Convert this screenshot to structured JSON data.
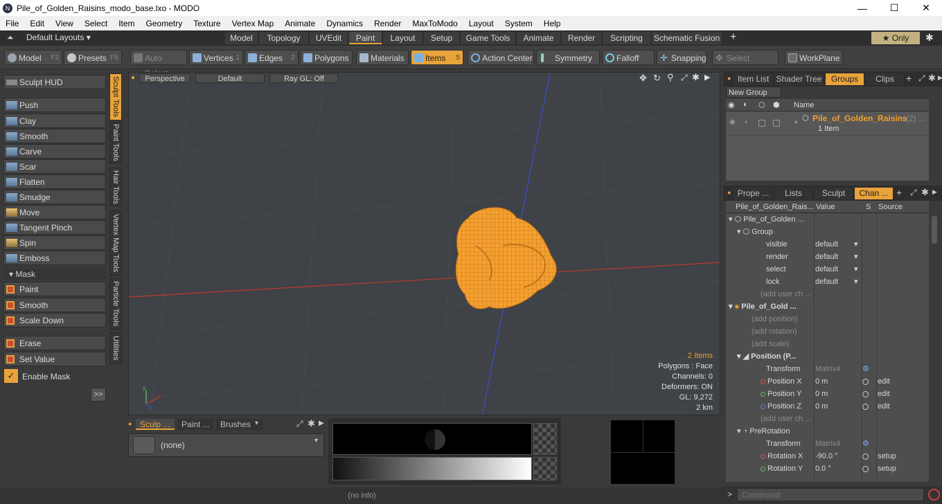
{
  "window": {
    "title": "Pile_of_Golden_Raisins_modo_base.lxo - MODO",
    "minimize": "—",
    "maximize": "☐",
    "close": "✕"
  },
  "menu": [
    "File",
    "Edit",
    "View",
    "Select",
    "Item",
    "Geometry",
    "Texture",
    "Vertex Map",
    "Animate",
    "Dynamics",
    "Render",
    "MaxToModo",
    "Layout",
    "System",
    "Help"
  ],
  "layout_bar": {
    "layouts_label": "Default Layouts ▾",
    "tabs": [
      "Model",
      "Topology",
      "UVEdit",
      "Paint",
      "Layout",
      "Setup",
      "Game Tools",
      "Animate",
      "Render",
      "Scripting",
      "Schematic Fusion"
    ],
    "active_tab": "Paint",
    "add": "+",
    "only_label": "★  Only",
    "gear": "✱"
  },
  "toolbar": {
    "model": "Model",
    "model_key": "F2",
    "presets": "Presets",
    "presets_key": "F6",
    "auto_select": "Auto Select",
    "vertices": "Vertices",
    "vertices_key": "1",
    "edges": "Edges",
    "edges_key": "2",
    "polygons": "Polygons",
    "materials": "Materials",
    "items": "Items",
    "items_key": "5",
    "action_center": "Action Center",
    "symmetry": "Symmetry",
    "falloff": "Falloff",
    "snapping": "Snapping",
    "select_through": "Select Through",
    "workplane": "WorkPlane"
  },
  "left": {
    "hud": "Sculpt HUD",
    "tools": [
      "Push",
      "Clay",
      "Smooth",
      "Carve",
      "Scar",
      "Flatten",
      "Smudge",
      "Move",
      "Tangent Pinch",
      "Spin",
      "Emboss"
    ],
    "mask_label": "Mask",
    "mask_tools": [
      "Paint",
      "Smooth",
      "Scale Down"
    ],
    "erase": "Erase",
    "set_value": "Set Value",
    "enable_mask": "Enable Mask",
    "more": ">>",
    "side_tabs": [
      "Sculpt Tools",
      "Paint Tools",
      "Hair Tools",
      "Vertex Map Tools",
      "Particle Tools",
      "Utilities"
    ]
  },
  "viewport": {
    "perspective": "Perspective",
    "default": "Default",
    "raygl": "Ray GL: Off",
    "info": {
      "items": "2 Items",
      "polygons": "Polygons : Face",
      "channels": "Channels: 0",
      "deformers": "Deformers: ON",
      "gl": "GL: 9,272",
      "distance": "2 km"
    }
  },
  "bottom": {
    "tabs": [
      "Sculp ...",
      "Paint ...",
      "Brushes"
    ],
    "preset": "(none)"
  },
  "status": "(no info)",
  "groups_panel": {
    "tabs": [
      "Item List",
      "Shader Tree",
      "Groups",
      "Clips"
    ],
    "active": "Groups",
    "new_group": "New Group",
    "name_header": "Name",
    "group_name": "Pile_of_Golden_Raisins",
    "group_count": "(2) ...",
    "group_sub": "1 Item"
  },
  "channels_panel": {
    "tabs": [
      "Prope ...",
      "Lists",
      "Sculpt",
      "Chan ..."
    ],
    "active": "Chan ...",
    "headers": [
      "Pile_of_Golden_Rais...",
      "Value",
      "S",
      "Source"
    ],
    "rows": [
      {
        "name": "Pile_of_Golden ...",
        "value": "",
        "s": "",
        "src": ""
      },
      {
        "name": "Group",
        "value": "",
        "s": "",
        "src": ""
      },
      {
        "name": "visible",
        "value": "default",
        "s": "",
        "src": ""
      },
      {
        "name": "render",
        "value": "default",
        "s": "",
        "src": ""
      },
      {
        "name": "select",
        "value": "default",
        "s": "",
        "src": ""
      },
      {
        "name": "lock",
        "value": "default",
        "s": "",
        "src": ""
      },
      {
        "name": "(add user ch ...",
        "value": "",
        "s": "",
        "src": ""
      },
      {
        "name": "Pile_of_Gold ...",
        "value": "",
        "s": "",
        "src": ""
      },
      {
        "name": "(add position)",
        "value": "",
        "s": "",
        "src": ""
      },
      {
        "name": "(add rotation)",
        "value": "",
        "s": "",
        "src": ""
      },
      {
        "name": "(add scale)",
        "value": "",
        "s": "",
        "src": ""
      },
      {
        "name": "Position (P...",
        "value": "",
        "s": "",
        "src": ""
      },
      {
        "name": "Transform",
        "value": "Matrix4",
        "s": "",
        "src": ""
      },
      {
        "name": "Position X",
        "value": "0 m",
        "s": "",
        "src": "edit"
      },
      {
        "name": "Position Y",
        "value": "0 m",
        "s": "",
        "src": "edit"
      },
      {
        "name": "Position Z",
        "value": "0 m",
        "s": "",
        "src": "edit"
      },
      {
        "name": "(add user ch ...",
        "value": "",
        "s": "",
        "src": ""
      },
      {
        "name": "PreRotation",
        "value": "",
        "s": "",
        "src": ""
      },
      {
        "name": "Transform",
        "value": "Matrix4",
        "s": "",
        "src": ""
      },
      {
        "name": "Rotation X",
        "value": "-90.0 °",
        "s": "",
        "src": "setup"
      },
      {
        "name": "Rotation Y",
        "value": "0.0 °",
        "s": "",
        "src": "setup"
      }
    ]
  },
  "command": {
    "placeholder": "Command",
    "prompt": ">"
  },
  "colors": {
    "accent": "#e8a33a",
    "mesh": "#f5a030",
    "axis_x": "#c0392b",
    "axis_y": "#3a4fd0"
  }
}
